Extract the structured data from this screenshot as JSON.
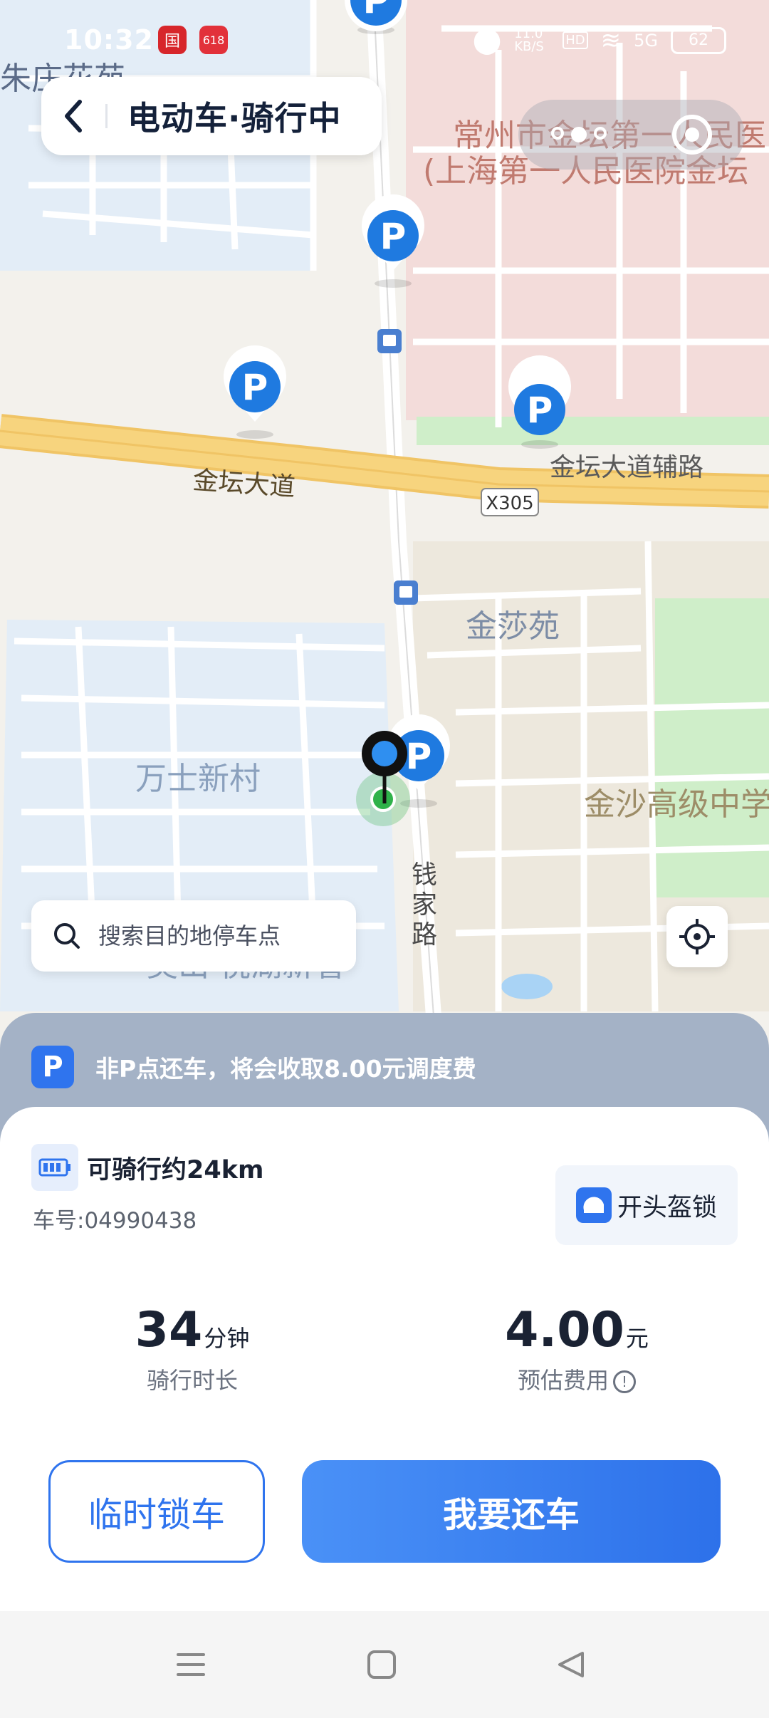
{
  "status_bar": {
    "time": "10:32",
    "app_badges": [
      "国",
      "618"
    ],
    "speed": "11.0 KB/S",
    "network": "5G",
    "hd": "HD",
    "battery": "62"
  },
  "header": {
    "title": "电动车·骑行中"
  },
  "map": {
    "labels": {
      "hospital_1": "常州市金坛第一人民医",
      "hospital_2": "(上海第一人民医院金坛",
      "avenue": "金坛大道",
      "aux_road": "金坛大道辅路",
      "road_code": "X305",
      "jinsha_garden": "金莎苑",
      "wanshi_village": "万士新村",
      "school": "金沙高级中学",
      "qianjia_road": "钱家路",
      "aoshan": "奥山·悦湖新著",
      "zhuzhuang": "朱庄花苑"
    }
  },
  "search": {
    "placeholder": "搜索目的地停车点"
  },
  "notice": {
    "badge": "P",
    "text": "非P点还车，将会收取8.00元调度费"
  },
  "ride": {
    "range": "可骑行约24km",
    "bike_number": "车号:04990438",
    "helmet_button": "开头盔锁",
    "duration_value": "34",
    "duration_unit": "分钟",
    "duration_label": "骑行时长",
    "cost_value": "4.00",
    "cost_unit": "元",
    "cost_label": "预估费用",
    "info_glyph": "!"
  },
  "actions": {
    "temp_lock": "临时锁车",
    "return_bike": "我要还车"
  },
  "colors": {
    "accent": "#2f74ee",
    "notice_bg": "#a4b2c6",
    "map_land": "#f3f1ec",
    "map_residential": "#e3edf7",
    "map_hospital": "#f3dcda",
    "map_green": "#cfeec9",
    "map_road_major": "#f7d47e"
  }
}
